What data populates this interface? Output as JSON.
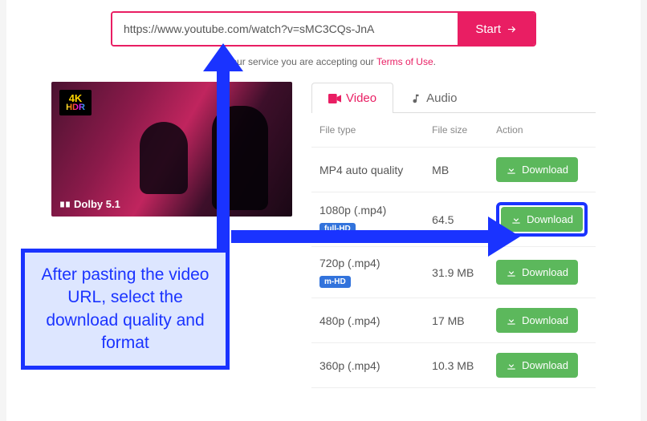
{
  "urlbar": {
    "value": "https://www.youtube.com/watch?v=sMC3CQs-JnA",
    "start_label": "Start"
  },
  "terms": {
    "prefix": "sing our service you are accepting our ",
    "link": "Terms of Use"
  },
  "thumb": {
    "badge_top": "4K",
    "badge_bottom": "HDR",
    "dolby": "Dolby 5.1"
  },
  "tabs": {
    "video": "Video",
    "audio": "Audio"
  },
  "table": {
    "headers": {
      "type": "File type",
      "size": "File size",
      "action": "Action"
    },
    "download_label": "Download",
    "rows": [
      {
        "type": "MP4 auto quality",
        "badge": "",
        "size": "MB",
        "highlight": false
      },
      {
        "type": "1080p (.mp4)",
        "badge": "full-HD",
        "size": "64.5",
        "highlight": true
      },
      {
        "type": "720p (.mp4)",
        "badge": "m-HD",
        "size": "31.9 MB",
        "highlight": false
      },
      {
        "type": "480p (.mp4)",
        "badge": "",
        "size": "17 MB",
        "highlight": false
      },
      {
        "type": "360p (.mp4)",
        "badge": "",
        "size": "10.3 MB",
        "highlight": false
      }
    ]
  },
  "callout": "After pasting the video URL, select the download quality and format"
}
